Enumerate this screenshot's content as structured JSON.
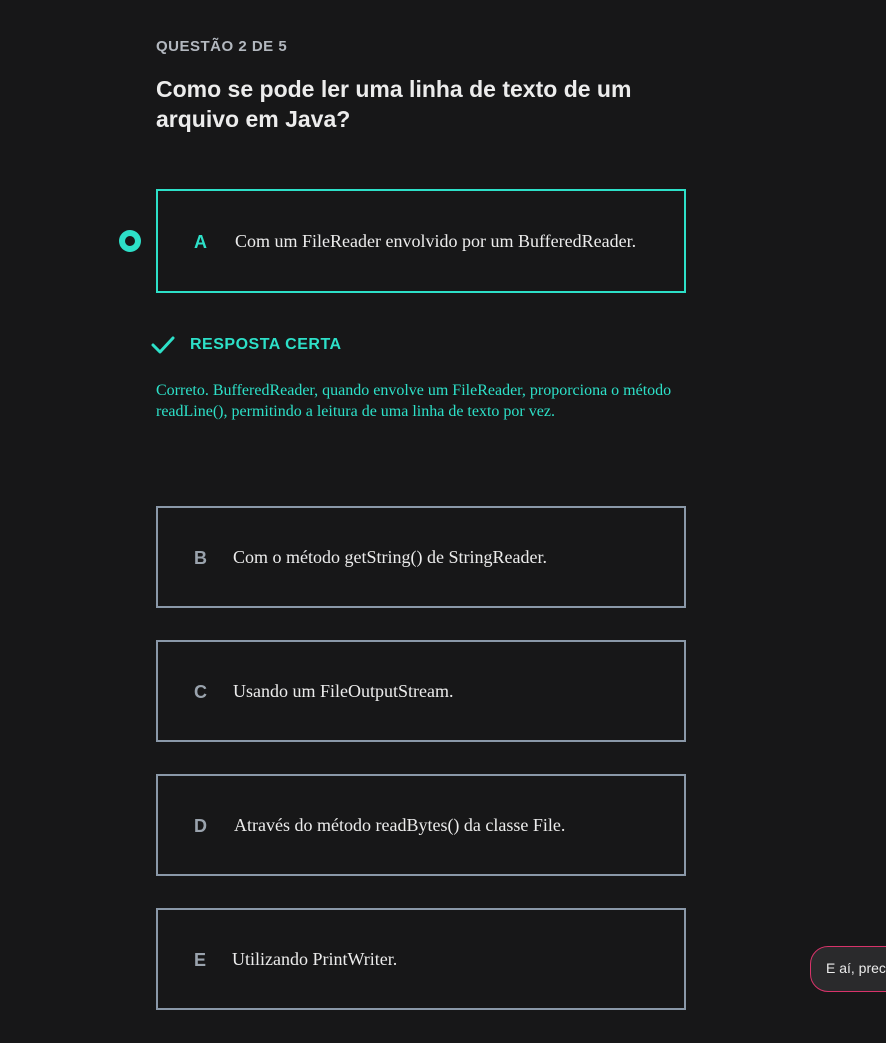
{
  "question": {
    "counter": "QUESTÃO 2 DE 5",
    "title": "Como se pode ler uma linha de texto de um arquivo em Java?"
  },
  "options": [
    {
      "letter": "A",
      "text": "Com um FileReader envolvido por um BufferedReader.",
      "selected": true
    },
    {
      "letter": "B",
      "text": "Com o método getString() de StringReader.",
      "selected": false
    },
    {
      "letter": "C",
      "text": "Usando um FileOutputStream.",
      "selected": false
    },
    {
      "letter": "D",
      "text": "Através do método readBytes() da classe File.",
      "selected": false
    },
    {
      "letter": "E",
      "text": "Utilizando PrintWriter.",
      "selected": false
    }
  ],
  "feedback": {
    "label": "RESPOSTA CERTA",
    "explanation": "Correto. BufferedReader, quando envolve um FileReader, proporciona o método readLine(), permitindo a leitura de uma linha de texto por vez.",
    "icon": "check-icon"
  },
  "chat": {
    "text": "E aí, prec"
  },
  "colors": {
    "background": "#171718",
    "accent": "#2de0c8",
    "option_border": "#8a98a8",
    "chat_border": "#d8336a"
  }
}
